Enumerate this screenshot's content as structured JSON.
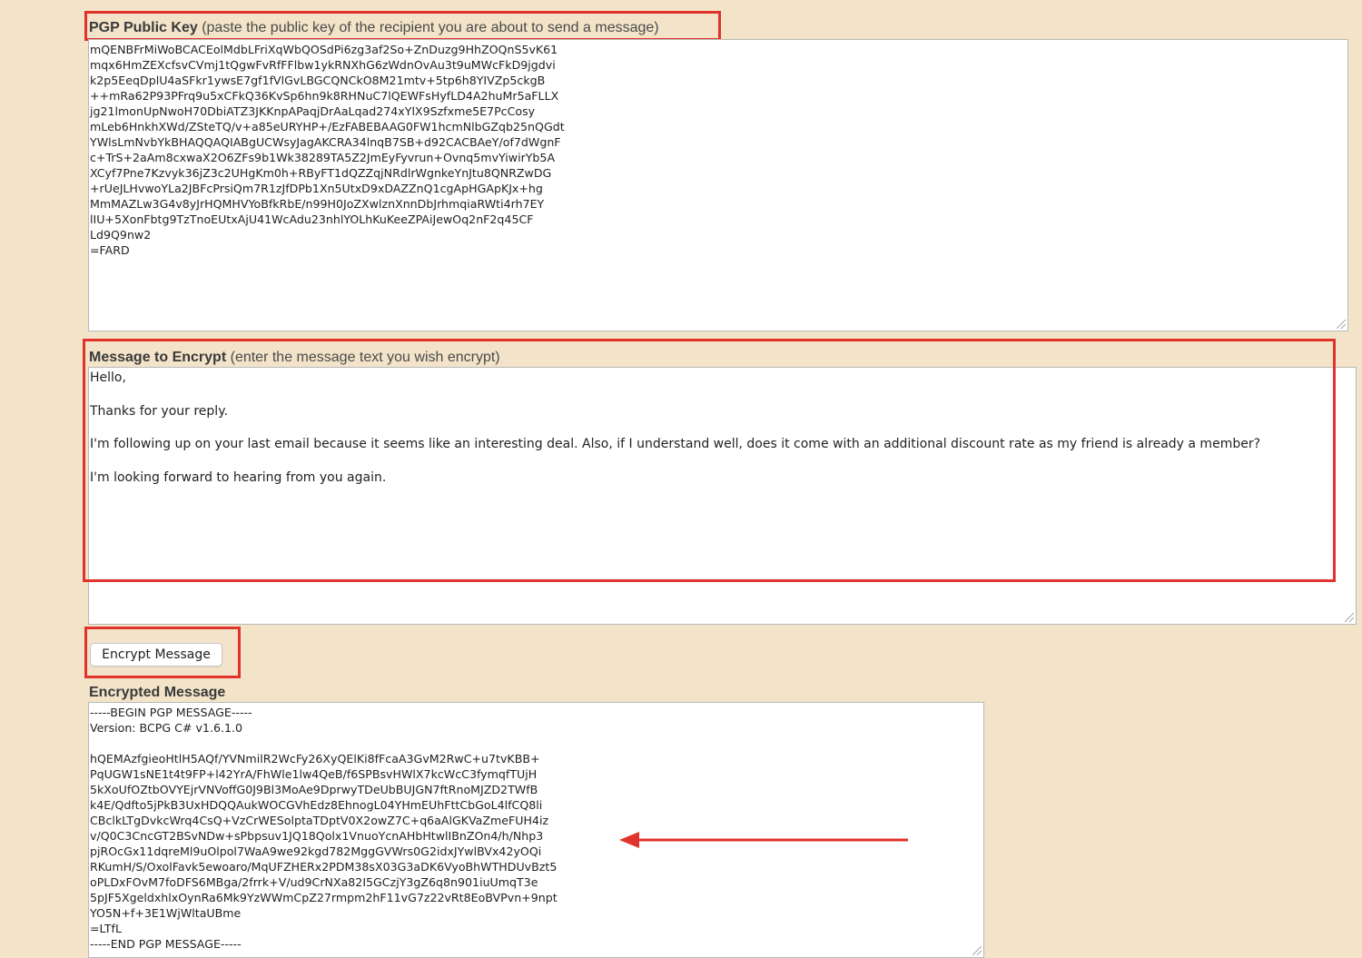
{
  "pgp_key": {
    "label_bold": "PGP Public Key",
    "label_hint": "(paste the public key of the recipient you are about to send a message)",
    "lines": [
      "mQENBFrMiWoBCACEolMdbLFriXqWbQOSdPi6zg3af2So+ZnDuzg9HhZOQnS5vK61",
      "mqx6HmZEXcfsvCVmj1tQgwFvRfFFlbw1ykRNXhG6zWdnOvAu3t9uMWcFkD9jgdvi",
      "k2p5EeqDplU4aSFkr1ywsE7gf1fVlGvLBGCQNCkO8M21mtv+5tp6h8YIVZp5ckgB",
      "++mRa62P93PFrq9u5xCFkQ36KvSp6hn9k8RHNuC7lQEWFsHyfLD4A2huMr5aFLLX",
      "jg21lmonUpNwoH70DbiATZ3JKKnpAPaqjDrAaLqad274xYlX9Szfxme5E7PcCosy",
      "mLeb6HnkhXWd/ZSteTQ/v+a85eURYHP+/EzFABEBAAG0FW1hcmNlbGZqb25nQGdt",
      "YWlsLmNvbYkBHAQQAQIABgUCWsyJagAKCRA34lnqB7SB+d92CACBAeY/of7dWgnF",
      "c+TrS+2aAm8cxwaX2O6ZFs9b1Wk38289TA5Z2JmEyFyvrun+Ovnq5mvYiwirYb5A",
      "XCyf7Pne7Kzvyk36jZ3c2UHgKm0h+RByFT1dQZZqjNRdlrWgnkeYnJtu8QNRZwDG",
      "+rUeJLHvwoYLa2JBFcPrsiQm7R1zJfDPb1Xn5UtxD9xDAZZnQ1cgApHGApKJx+hg",
      "MmMAZLw3G4v8yJrHQMHVYoBfkRbE/n99H0JoZXwlznXnnDbJrhmqiaRWti4rh7EY",
      "lIU+5XonFbtg9TzTnoEUtxAjU41WcAdu23nhlYOLhKuKeeZPAiJewOq2nF2q45CF",
      "Ld9Q9nw2",
      "=FARD"
    ]
  },
  "message": {
    "label_bold": "Message to Encrypt",
    "label_hint": "(enter the message text you wish encrypt)",
    "paragraphs": [
      "Hello,",
      "Thanks for your reply.",
      "I'm following up on your last email because it seems like an interesting deal. Also, if I understand well, does it come with an additional discount rate as my friend is already a member?",
      "I'm looking forward to hearing from you again."
    ]
  },
  "encrypt_button": {
    "label": "Encrypt Message"
  },
  "encrypted": {
    "label": "Encrypted Message",
    "lines": [
      "-----BEGIN PGP MESSAGE-----",
      "Version: BCPG C# v1.6.1.0",
      "",
      "hQEMAzfgieoHtlH5AQf/YVNmilR2WcFy26XyQElKi8fFcaA3GvM2RwC+u7tvKBB+",
      "PqUGW1sNE1t4t9FP+l42YrA/FhWle1lw4QeB/f6SPBsvHWlX7kcWcC3fymqfTUjH",
      "5kXoUfOZtbOVYEjrVNVoffG0J9Bl3MoAe9DprwyTDeUbBUJGN7ftRnoMJZD2TWfB",
      "k4E/Qdfto5jPkB3UxHDQQAukWOCGVhEdz8EhnogL04YHmEUhFttCbGoL4lfCQ8li",
      "CBclkLTgDvkcWrq4CsQ+VzCrWESolptaTDptV0X2owZ7C+q6aAlGKVaZmeFUH4iz",
      "v/Q0C3CncGT2BSvNDw+sPbpsuv1JQ18Qolx1VnuoYcnAHbHtwlIBnZOn4/h/Nhp3",
      "pjROcGx11dqreMl9uOlpol7WaA9we92kgd782MggGVWrs0G2idxJYwlBVx42yOQi",
      "RKumH/S/OxolFavk5ewoaro/MqUFZHERx2PDM38sX03G3aDK6VyoBhWTHDUvBzt5",
      "oPLDxFOvM7foDFS6MBga/2frrk+V/ud9CrNXa82I5GCzjY3gZ6q8n901iuUmqT3e",
      "5pJF5XgeldxhlxOynRa6Mk9YzWWmCpZ27rmpm2hF11vG7z22vRt8EoBVPvn+9npt",
      "YO5N+f+3E1WjWltaUBme",
      "=LTfL",
      "-----END PGP MESSAGE-----"
    ]
  },
  "colors": {
    "background": "#f3e4c9",
    "highlight": "#e0332b"
  }
}
